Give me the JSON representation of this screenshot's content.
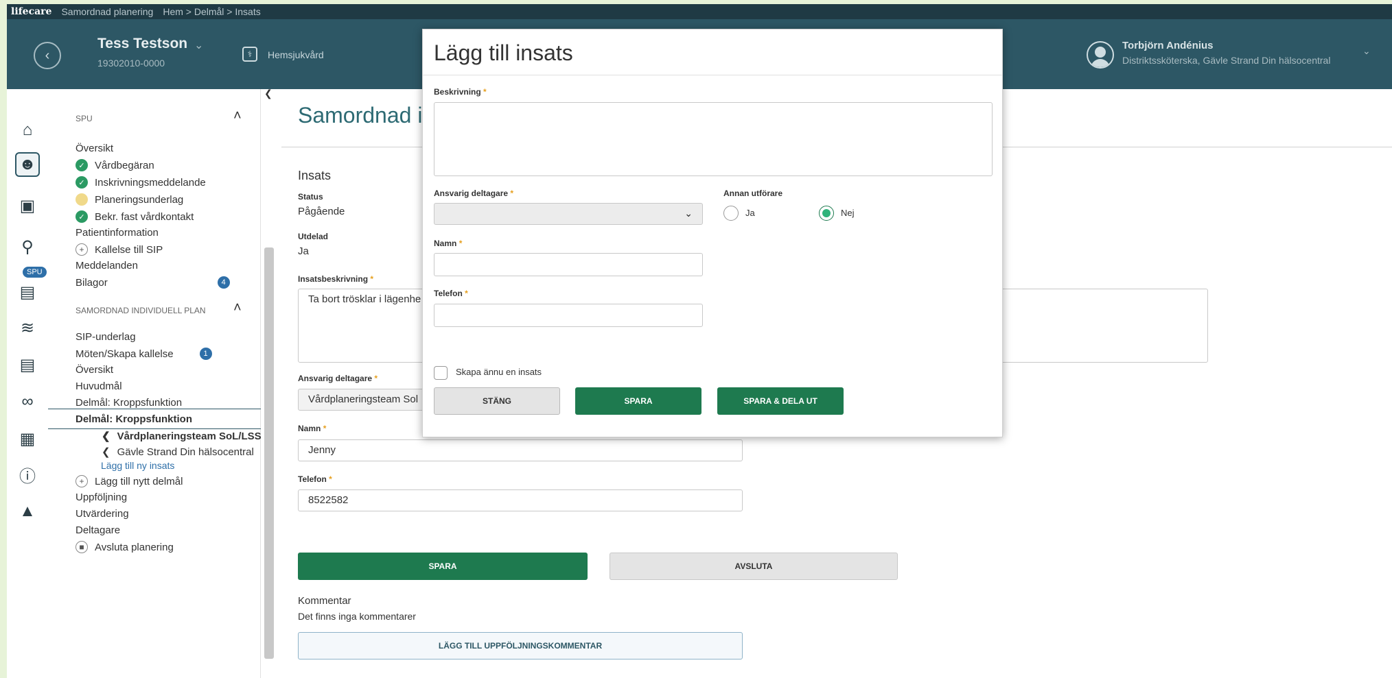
{
  "topbar": {
    "brand": "lifecare",
    "module": "Samordnad planering",
    "breadcrumb": "Hem > Delmål > Insats"
  },
  "header": {
    "patient_name": "Tess Testson",
    "patient_id": "19302010-0000",
    "unit": "Hemsjukvård",
    "user_name": "Torbjörn Andénius",
    "user_role": "Distriktssköterska, Gävle Strand Din hälsocentral"
  },
  "rail": {
    "icons": [
      "home-icon",
      "patient-icon",
      "inbox-icon",
      "search-icon",
      "bed-icon",
      "chart-icon",
      "document-icon",
      "link-icon",
      "form-icon",
      "help-icon",
      "graduation-cap-icon"
    ],
    "spu_pill": "SPU"
  },
  "sidebar": {
    "section1": "SPU",
    "items1": [
      {
        "label": "Översikt"
      },
      {
        "label": "Vårdbegäran",
        "status": "done"
      },
      {
        "label": "Inskrivningsmeddelande",
        "status": "done"
      },
      {
        "label": "Planeringsunderlag",
        "status": "pending"
      },
      {
        "label": "Bekr. fast vårdkontakt",
        "status": "done"
      },
      {
        "label": "Patientinformation"
      },
      {
        "label": "Kallelse till SIP",
        "status": "add"
      },
      {
        "label": "Meddelanden"
      },
      {
        "label": "Bilagor",
        "badge": "4"
      }
    ],
    "section2": "SAMORDNAD INDIVIDUELL PLAN",
    "items2": [
      {
        "label": "SIP-underlag"
      },
      {
        "label": "Möten/Skapa kallelse",
        "badge": "1"
      },
      {
        "label": "Översikt"
      },
      {
        "label": "Huvudmål"
      },
      {
        "label": "Delmål: Kroppsfunktion"
      },
      {
        "label": "Delmål: Kroppsfunktion"
      },
      {
        "label": "Vårdplaneringsteam SoL/LSS O"
      },
      {
        "label": "Gävle Strand Din hälsocentral"
      },
      {
        "label": "Lägg till ny insats"
      },
      {
        "label": "Lägg till nytt delmål"
      },
      {
        "label": "Uppföljning"
      },
      {
        "label": "Utvärdering"
      },
      {
        "label": "Deltagare"
      },
      {
        "label": "Avsluta planering"
      }
    ]
  },
  "main": {
    "title": "Samordnad i",
    "section": "Insats",
    "status_label": "Status",
    "status_value": "Pågående",
    "utdelad_label": "Utdelad",
    "utdelad_value": "Ja",
    "desc_label": "Insatsbeskrivning",
    "desc_value": "Ta bort trösklar i lägenhe",
    "ansvarig_label": "Ansvarig deltagare",
    "ansvarig_value": "Vårdplaneringsteam Sol",
    "namn_label": "Namn",
    "namn_value": "Jenny",
    "telefon_label": "Telefon",
    "telefon_value": "8522582",
    "save_button": "SPARA",
    "finish_button": "AVSLUTA",
    "comment_heading": "Kommentar",
    "comment_empty": "Det finns inga kommentarer",
    "add_comment_button": "LÄGG TILL UPPFÖLJNINGSKOMMENTAR"
  },
  "modal": {
    "title": "Lägg till insats",
    "beskrivning_label": "Beskrivning",
    "ansvarig_label": "Ansvarig deltagare",
    "annan_label": "Annan utförare",
    "radio_ja": "Ja",
    "radio_nej": "Nej",
    "radio_selected": "Nej",
    "namn_label": "Namn",
    "telefon_label": "Telefon",
    "checkbox_label": "Skapa ännu en insats",
    "close_button": "STÄNG",
    "save_button": "SPARA",
    "save_share_button": "SPARA & DELA UT",
    "required_mark": "*"
  },
  "colors": {
    "header_bg": "#2d5765",
    "accent_green": "#1e7a4f",
    "title_teal": "#2d6a73",
    "badge_blue": "#2e6fa8"
  }
}
